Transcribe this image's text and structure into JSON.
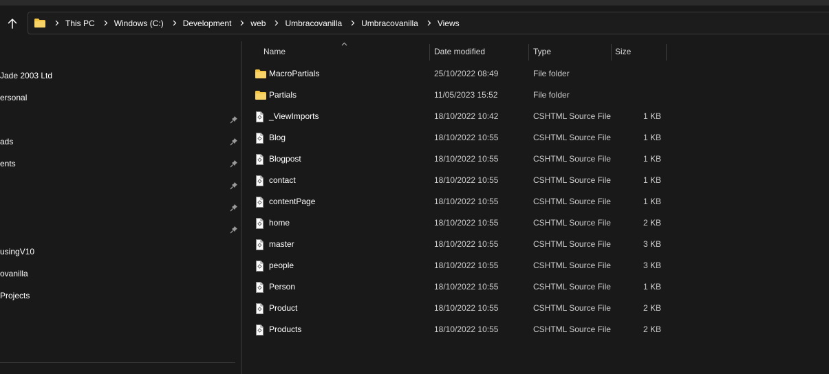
{
  "address_bar": {
    "crumbs": [
      "This PC",
      "Windows (C:)",
      "Development",
      "web",
      "Umbracovanilla",
      "Umbracovanilla",
      "Views"
    ]
  },
  "nav_pane": {
    "items": [
      {
        "label": "Jade 2003 Ltd",
        "pinned": false
      },
      {
        "label": "ersonal",
        "pinned": false
      },
      {
        "label": "",
        "pinned": true
      },
      {
        "label": "ads",
        "pinned": true
      },
      {
        "label": "ents",
        "pinned": true
      },
      {
        "label": "",
        "pinned": true
      },
      {
        "label": "",
        "pinned": true
      },
      {
        "label": "",
        "pinned": true
      },
      {
        "label": "usingV10",
        "pinned": false
      },
      {
        "label": "ovanilla",
        "pinned": false
      },
      {
        "label": "Projects",
        "pinned": false
      }
    ]
  },
  "columns": {
    "name": "Name",
    "date": "Date modified",
    "type": "Type",
    "size": "Size"
  },
  "files": [
    {
      "name": "MacroPartials",
      "date": "25/10/2022 08:49",
      "type": "File folder",
      "size": "",
      "icon": "folder-icon"
    },
    {
      "name": "Partials",
      "date": "11/05/2023 15:52",
      "type": "File folder",
      "size": "",
      "icon": "folder-icon"
    },
    {
      "name": "_ViewImports",
      "date": "18/10/2022 10:42",
      "type": "CSHTML Source File",
      "size": "1 KB",
      "icon": "cshtml-file-icon"
    },
    {
      "name": "Blog",
      "date": "18/10/2022 10:55",
      "type": "CSHTML Source File",
      "size": "1 KB",
      "icon": "cshtml-file-icon"
    },
    {
      "name": "Blogpost",
      "date": "18/10/2022 10:55",
      "type": "CSHTML Source File",
      "size": "1 KB",
      "icon": "cshtml-file-icon"
    },
    {
      "name": "contact",
      "date": "18/10/2022 10:55",
      "type": "CSHTML Source File",
      "size": "1 KB",
      "icon": "cshtml-file-icon"
    },
    {
      "name": "contentPage",
      "date": "18/10/2022 10:55",
      "type": "CSHTML Source File",
      "size": "1 KB",
      "icon": "cshtml-file-icon"
    },
    {
      "name": "home",
      "date": "18/10/2022 10:55",
      "type": "CSHTML Source File",
      "size": "2 KB",
      "icon": "cshtml-file-icon"
    },
    {
      "name": "master",
      "date": "18/10/2022 10:55",
      "type": "CSHTML Source File",
      "size": "3 KB",
      "icon": "cshtml-file-icon"
    },
    {
      "name": "people",
      "date": "18/10/2022 10:55",
      "type": "CSHTML Source File",
      "size": "3 KB",
      "icon": "cshtml-file-icon"
    },
    {
      "name": "Person",
      "date": "18/10/2022 10:55",
      "type": "CSHTML Source File",
      "size": "1 KB",
      "icon": "cshtml-file-icon"
    },
    {
      "name": "Product",
      "date": "18/10/2022 10:55",
      "type": "CSHTML Source File",
      "size": "2 KB",
      "icon": "cshtml-file-icon"
    },
    {
      "name": "Products",
      "date": "18/10/2022 10:55",
      "type": "CSHTML Source File",
      "size": "2 KB",
      "icon": "cshtml-file-icon"
    }
  ],
  "colors": {
    "background": "#191919",
    "folder": "#f4c542",
    "text": "#ffffff",
    "muted_text": "#cfcfcf"
  }
}
